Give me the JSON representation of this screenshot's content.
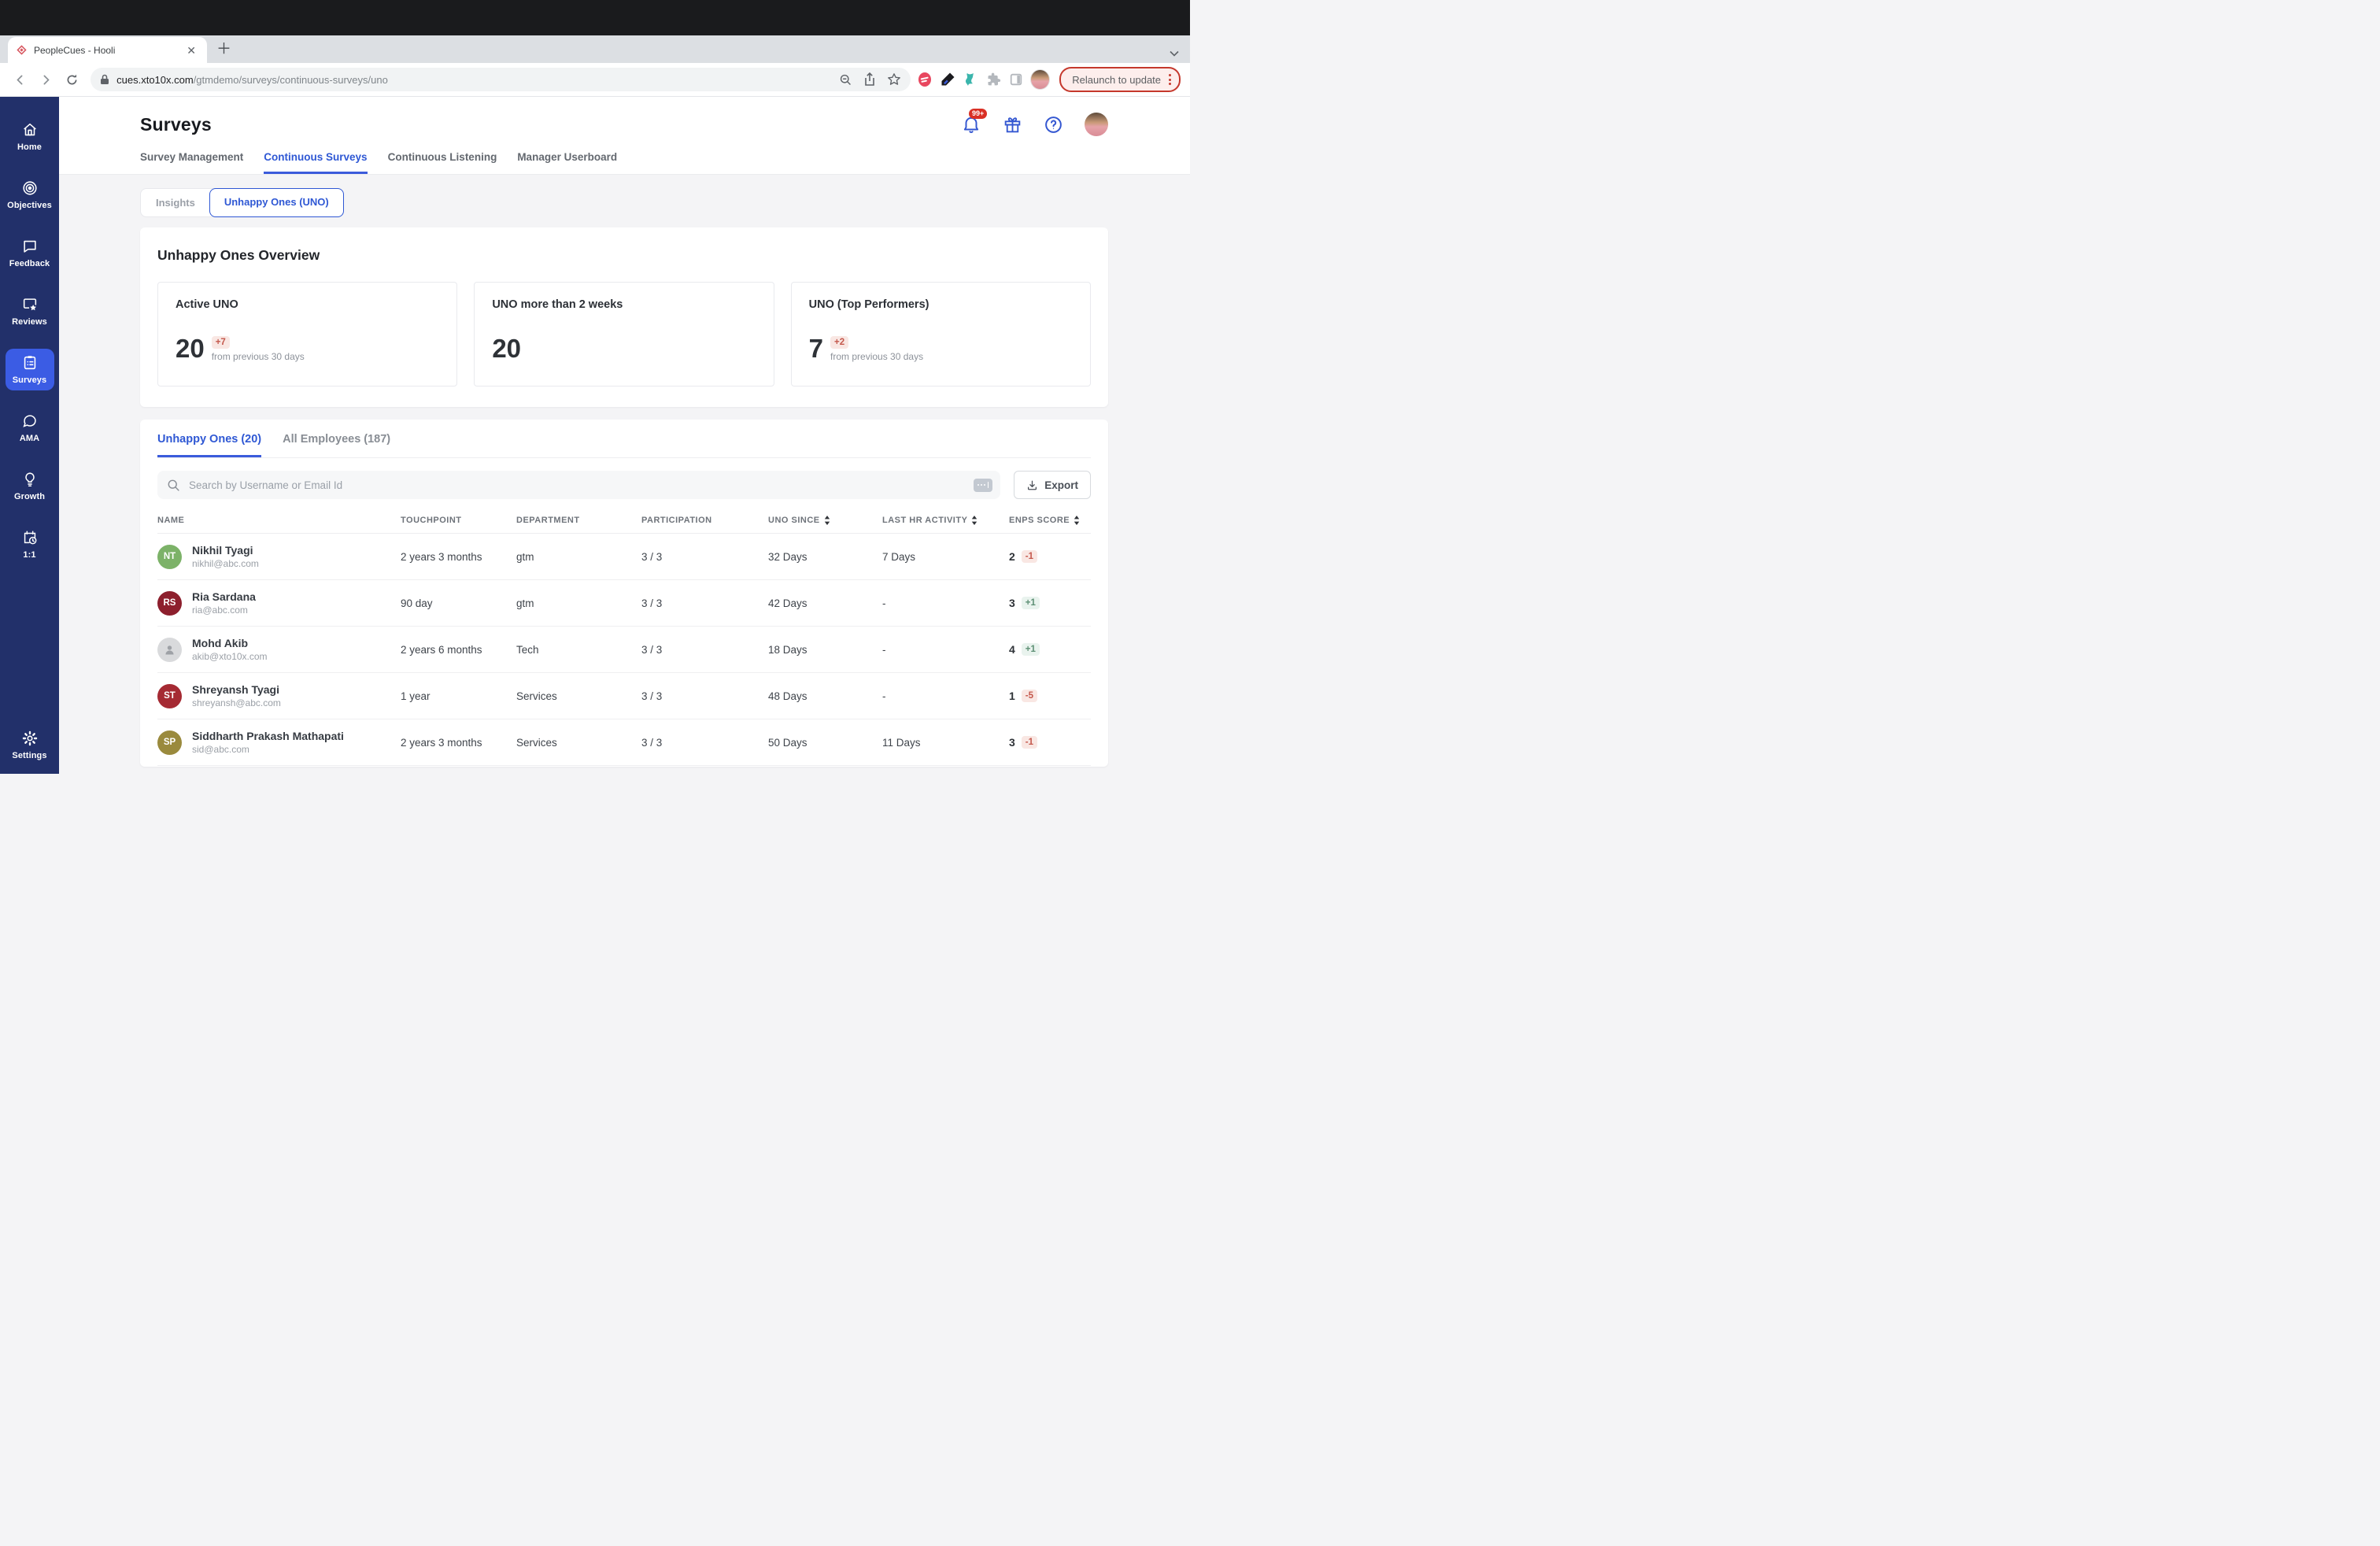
{
  "browser": {
    "tab_title": "PeopleCues - Hooli",
    "url_host": "cues.xto10x.com",
    "url_path": "/gtmdemo/surveys/continuous-surveys/uno",
    "relaunch_label": "Relaunch to update"
  },
  "sidebar": {
    "items": [
      {
        "label": "Home",
        "icon": "home-icon",
        "active": false
      },
      {
        "label": "Objectives",
        "icon": "target-icon",
        "active": false
      },
      {
        "label": "Feedback",
        "icon": "chat-bubble-icon",
        "active": false
      },
      {
        "label": "Reviews",
        "icon": "screen-star-icon",
        "active": false
      },
      {
        "label": "Surveys",
        "icon": "clipboard-list-icon",
        "active": true
      },
      {
        "label": "AMA",
        "icon": "speech-bubble-icon",
        "active": false
      },
      {
        "label": "Growth",
        "icon": "lightbulb-icon",
        "active": false
      },
      {
        "label": "1:1",
        "icon": "calendar-clock-icon",
        "active": false
      },
      {
        "label": "Settings",
        "icon": "gear-icon",
        "active": false
      }
    ]
  },
  "header": {
    "title": "Surveys",
    "notification_badge": "99+",
    "tabs": [
      {
        "label": "Survey Management",
        "active": false
      },
      {
        "label": "Continuous Surveys",
        "active": true
      },
      {
        "label": "Continuous Listening",
        "active": false
      },
      {
        "label": "Manager Userboard",
        "active": false
      }
    ]
  },
  "view_toggle": {
    "options": [
      {
        "label": "Insights",
        "active": false
      },
      {
        "label": "Unhappy Ones (UNO)",
        "active": true
      }
    ]
  },
  "overview": {
    "title": "Unhappy Ones Overview",
    "cards": [
      {
        "title": "Active UNO",
        "value": "20",
        "delta": "+7",
        "caption": "from previous 30 days"
      },
      {
        "title": "UNO more than 2 weeks",
        "value": "20",
        "delta": "",
        "caption": ""
      },
      {
        "title": "UNO (Top Performers)",
        "value": "7",
        "delta": "+2",
        "caption": "from previous 30 days"
      }
    ]
  },
  "table_section": {
    "tabs": [
      {
        "label": "Unhappy Ones (20)",
        "active": true
      },
      {
        "label": "All Employees (187)",
        "active": false
      }
    ],
    "search_placeholder": "Search by Username or Email Id",
    "export_label": "Export",
    "columns": [
      "NAME",
      "TOUCHPOINT",
      "DEPARTMENT",
      "PARTICIPATION",
      "UNO SINCE",
      "LAST HR ACTIVITY",
      "ENPS SCORE"
    ],
    "rows": [
      {
        "initials": "NT",
        "avatar_color": "#7cb268",
        "name": "Nikhil Tyagi",
        "email": "nikhil@abc.com",
        "touchpoint": "2 years 3 months",
        "department": "gtm",
        "participation": "3 / 3",
        "uno_since": "32 Days",
        "last_hr_activity": "7 Days",
        "enps_score": "2",
        "enps_delta": "-1"
      },
      {
        "initials": "RS",
        "avatar_color": "#8d1f2d",
        "name": "Ria Sardana",
        "email": "ria@abc.com",
        "touchpoint": "90 day",
        "department": "gtm",
        "participation": "3 / 3",
        "uno_since": "42 Days",
        "last_hr_activity": "-",
        "enps_score": "3",
        "enps_delta": "+1"
      },
      {
        "initials": "",
        "avatar_color": "",
        "name": "Mohd Akib",
        "email": "akib@xto10x.com",
        "touchpoint": "2 years 6 months",
        "department": "Tech",
        "participation": "3 / 3",
        "uno_since": "18 Days",
        "last_hr_activity": "-",
        "enps_score": "4",
        "enps_delta": "+1"
      },
      {
        "initials": "ST",
        "avatar_color": "#a52a33",
        "name": "Shreyansh Tyagi",
        "email": "shreyansh@abc.com",
        "touchpoint": "1 year",
        "department": "Services",
        "participation": "3 / 3",
        "uno_since": "48 Days",
        "last_hr_activity": "-",
        "enps_score": "1",
        "enps_delta": "-5"
      },
      {
        "initials": "SP",
        "avatar_color": "#9a8a3d",
        "name": "Siddharth Prakash Mathapati",
        "email": "sid@abc.com",
        "touchpoint": "2 years 3 months",
        "department": "Services",
        "participation": "3 / 3",
        "uno_since": "50 Days",
        "last_hr_activity": "11 Days",
        "enps_score": "3",
        "enps_delta": "-1"
      }
    ]
  },
  "colors": {
    "accent_blue": "#2f58d4",
    "sidebar_navy": "#22306a",
    "sidebar_active": "#3b5ce4",
    "negative_chip_bg": "#f9e7e3",
    "negative_chip_text": "#c4584c",
    "positive_chip_bg": "#e9f3ee",
    "positive_chip_text": "#5d8f74",
    "notification_red": "#d93025"
  }
}
